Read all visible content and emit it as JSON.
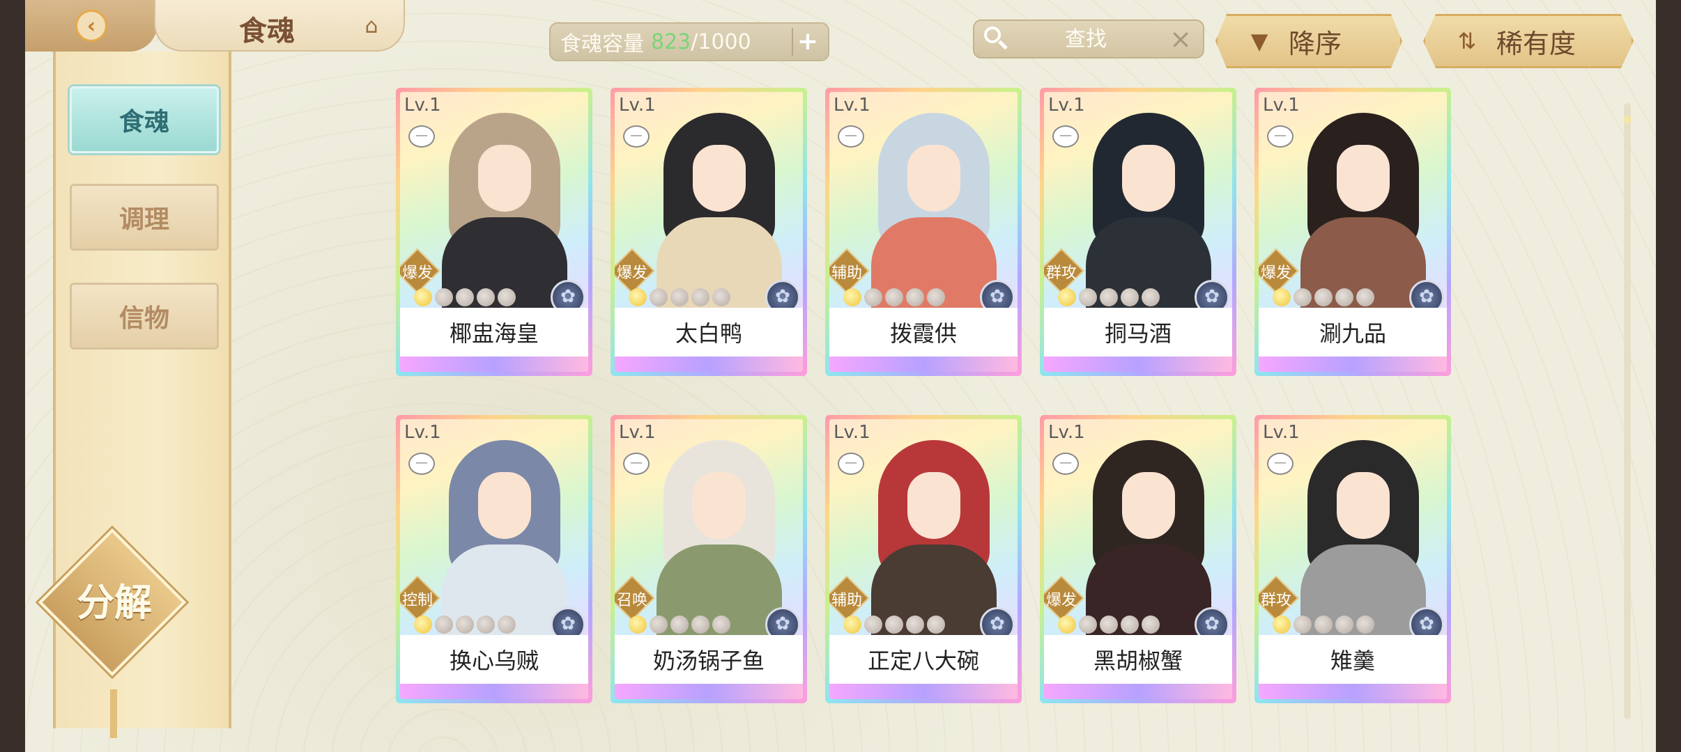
{
  "header": {
    "title": "食魂",
    "capacity_label": "食魂容量",
    "capacity_current": "823",
    "capacity_max": "/1000",
    "search_placeholder": "查找",
    "sort_order_label": "降序",
    "sort_field_label": "稀有度"
  },
  "sidebar": {
    "tabs": [
      {
        "label": "食魂",
        "active": true
      },
      {
        "label": "调理",
        "active": false
      },
      {
        "label": "信物",
        "active": false
      }
    ],
    "decompose_label": "分解"
  },
  "cards": [
    {
      "level": "Lv.1",
      "role": "爆发",
      "name": "椰盅海皇",
      "stars_gold": 1,
      "stars_total": 5,
      "hair": "#b9a48a",
      "body": "#2f2e33"
    },
    {
      "level": "Lv.1",
      "role": "爆发",
      "name": "太白鸭",
      "stars_gold": 1,
      "stars_total": 5,
      "hair": "#2b2a2d",
      "body": "#e8d8b8"
    },
    {
      "level": "Lv.1",
      "role": "辅助",
      "name": "拨霞供",
      "stars_gold": 1,
      "stars_total": 5,
      "hair": "#c8d6e2",
      "body": "#e07a66"
    },
    {
      "level": "Lv.1",
      "role": "群攻",
      "name": "挏马酒",
      "stars_gold": 1,
      "stars_total": 5,
      "hair": "#222832",
      "body": "#2c3138"
    },
    {
      "level": "Lv.1",
      "role": "爆发",
      "name": "涮九品",
      "stars_gold": 1,
      "stars_total": 5,
      "hair": "#2a211e",
      "body": "#8c5b4a"
    },
    {
      "level": "Lv.1",
      "role": "控制",
      "name": "换心乌贼",
      "stars_gold": 1,
      "stars_total": 5,
      "hair": "#7b88a8",
      "body": "#dfe7ee"
    },
    {
      "level": "Lv.1",
      "role": "召唤",
      "name": "奶汤锅子鱼",
      "stars_gold": 1,
      "stars_total": 5,
      "hair": "#e8e4dc",
      "body": "#8a9a6e"
    },
    {
      "level": "Lv.1",
      "role": "辅助",
      "name": "正定八大碗",
      "stars_gold": 1,
      "stars_total": 5,
      "hair": "#b8383a",
      "body": "#4a3b33"
    },
    {
      "level": "Lv.1",
      "role": "爆发",
      "name": "黑胡椒蟹",
      "stars_gold": 1,
      "stars_total": 5,
      "hair": "#2f2622",
      "body": "#3a2526"
    },
    {
      "level": "Lv.1",
      "role": "群攻",
      "name": "雉羹",
      "stars_gold": 1,
      "stars_total": 5,
      "hair": "#2b2a2a",
      "body": "#9c9c9c"
    }
  ]
}
